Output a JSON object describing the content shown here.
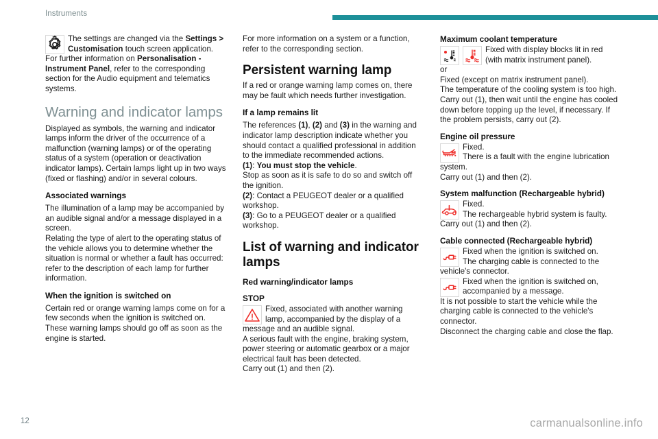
{
  "header": {
    "title": "Instruments",
    "rule_color": "#1d9099"
  },
  "footer": {
    "page_number": "12",
    "watermark": "carmanualsonline.info"
  },
  "column_left": {
    "settings_note_line1": "The settings are changed via the ",
    "settings_note_bold": "Settings > Customisation",
    "settings_note_line2": " touch screen application.",
    "further_info_pre": "For further information on ",
    "further_info_bold": "Personalisation - Instrument Panel",
    "further_info_post": ", refer to the corresponding section for the Audio equipment and telematics systems.",
    "heading_warning_lamps": "Warning and indicator lamps",
    "body_displayed": "Displayed as symbols, the warning and indicator lamps inform the driver of the occurrence of a malfunction (warning lamps) or of the operating status of a system (operation or deactivation indicator lamps). Certain lamps light up in two ways (fixed or flashing) and/or in several colours.",
    "heading_associated_warnings": "Associated warnings",
    "body_illumination": "The illumination of a lamp may be accompanied by an audible signal and/or a message displayed in a screen.",
    "body_relating": "Relating the type of alert to the operating status of the vehicle allows you to determine whether the situation is normal or whether a fault has occurred: refer to the description of each lamp for further information.",
    "heading_ignition_on": "When the ignition is switched on",
    "body_ignition": "Certain red or orange warning lamps come on for a few seconds when the ignition is switched on. These warning lamps should go off as soon as the engine is started."
  },
  "column_middle": {
    "body_more_info": "For more information on a system or a function, refer to the corresponding section.",
    "heading_persistent": "Persistent warning lamp",
    "body_persistent": "If a red or orange warning lamp comes on, there may be fault which needs further investigation.",
    "heading_lamp_lit": "If a lamp remains lit",
    "body_references_pre": "The references ",
    "ref_1": "(1)",
    "ref_sep1": ", ",
    "ref_2": "(2)",
    "ref_sep2": " and ",
    "ref_3": "(3)",
    "body_references_post": " in the warning and indicator lamp description indicate whether you should contact a qualified professional in addition to the immediate recommended actions.",
    "item1_label": "(1)",
    "item1_colon": ": ",
    "item1_bold": "You must stop the vehicle",
    "item1_end": ".",
    "item1_body": "Stop as soon as it is safe to do so and switch off the ignition.",
    "item2_label": "(2)",
    "item2_body": ": Contact a PEUGEOT dealer or a qualified workshop.",
    "item3_label": "(3)",
    "item3_body": ": Go to a PEUGEOT dealer or a qualified workshop.",
    "heading_list": "List of warning and indicator lamps",
    "heading_red_lamps": "Red warning/indicator lamps",
    "stop_heading": "STOP",
    "stop_icon": "warning-triangle-icon",
    "stop_body_1": "Fixed, associated with another warning lamp, accompanied by the display of a message and an audible signal.",
    "stop_body_2": "A serious fault with the engine, braking system, power steering or automatic gearbox or a major electrical fault has been detected.",
    "stop_body_3": "Carry out (1) and then (2)."
  },
  "column_right": {
    "coolant_heading": "Maximum coolant temperature",
    "coolant_icon_1": "coolant-temperature-matrix-icon",
    "coolant_icon_2": "coolant-temperature-icon",
    "coolant_body_1": "Fixed with display blocks lit in red (with matrix instrument panel).",
    "coolant_or": "or",
    "coolant_body_2": "Fixed (except on matrix instrument panel).",
    "coolant_body_3": "The temperature of the cooling system is too high.",
    "coolant_body_4": "Carry out (1), then wait until the engine has cooled down before topping up the level, if necessary. If the problem persists, carry out (2).",
    "oil_heading": "Engine oil pressure",
    "oil_icon": "oil-can-icon",
    "oil_body_1": "Fixed.",
    "oil_body_2": "There is a fault with the engine lubrication system.",
    "oil_body_3": "Carry out (1) and then (2).",
    "hybrid_heading": "System malfunction (Rechargeable hybrid)",
    "hybrid_icon": "car-fault-icon",
    "hybrid_body_1": "Fixed.",
    "hybrid_body_2": "The rechargeable hybrid system is faulty.",
    "hybrid_body_3": "Carry out (1) and then (2).",
    "cable_heading": "Cable connected (Rechargeable hybrid)",
    "cable_icon_1": "charging-plug-icon",
    "cable_body_1": "Fixed when the ignition is switched on.",
    "cable_body_2": "The charging cable is connected to the vehicle's connector.",
    "cable_icon_2": "charging-plug-warning-icon",
    "cable_body_3": "Fixed when the ignition is switched on, accompanied by a message.",
    "cable_body_4": "It is not possible to start the vehicle while the charging cable is connected to the vehicle's connector.",
    "cable_body_5": "Disconnect the charging cable and close the flap."
  },
  "colors": {
    "accent_teal": "#1d9099",
    "heading_grey": "#7f9093",
    "icon_red": "#ee2b27"
  }
}
